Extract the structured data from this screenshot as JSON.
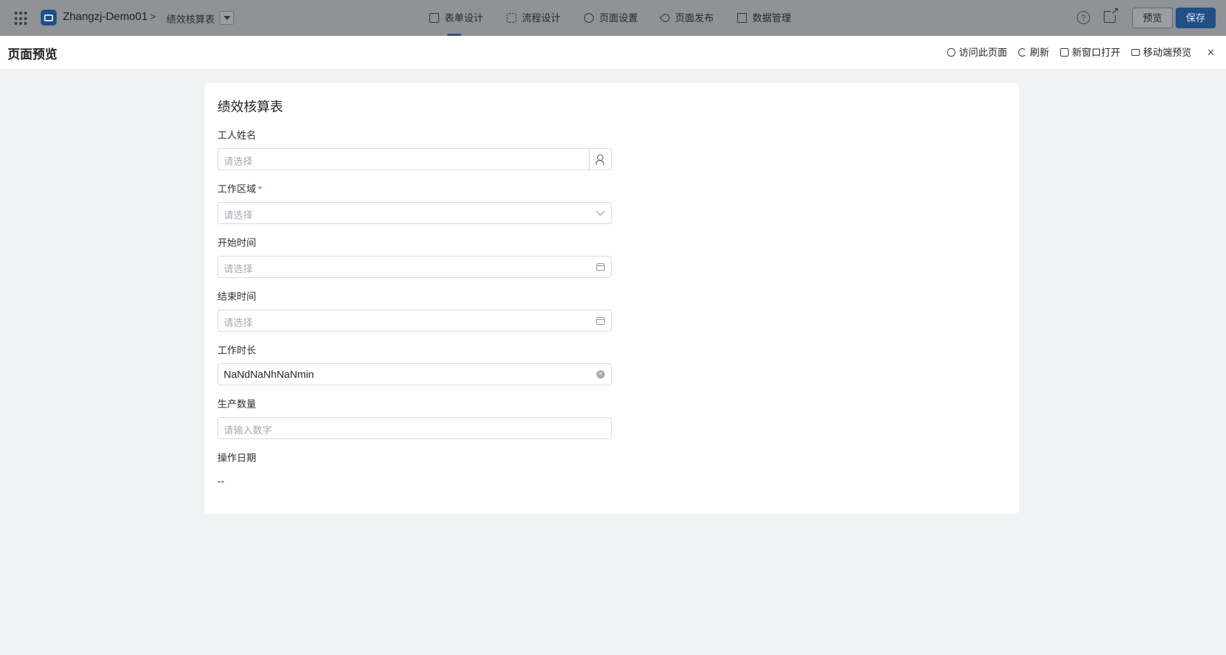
{
  "topbar": {
    "app_name": "Zhangzj-Demo01",
    "breadcrumb_separator": ">",
    "form_name": "绩效核算表",
    "tabs": [
      {
        "label": "表单设计",
        "icon": "document-icon"
      },
      {
        "label": "流程设计",
        "icon": "flow-icon"
      },
      {
        "label": "页面设置",
        "icon": "gear-icon"
      },
      {
        "label": "页面发布",
        "icon": "send-icon"
      },
      {
        "label": "数据管理",
        "icon": "table-icon"
      }
    ],
    "active_tab": "表单设计",
    "help_label": "?",
    "preview_label": "预览",
    "save_label": "保存"
  },
  "panel": {
    "title": "页面预览",
    "actions": [
      {
        "label": "访问此页面",
        "icon": "eye-icon"
      },
      {
        "label": "刷新",
        "icon": "refresh-icon"
      },
      {
        "label": "新窗口打开",
        "icon": "new-window-icon"
      },
      {
        "label": "移动端预览",
        "icon": "mobile-icon"
      }
    ],
    "close_label": "×"
  },
  "form": {
    "title": "绩效核算表",
    "fields": [
      {
        "label": "工人姓名",
        "placeholder": "请选择",
        "type": "user-select"
      },
      {
        "label": "工作区域",
        "required_mark": "*",
        "placeholder": "请选择",
        "type": "select"
      },
      {
        "label": "开始时间",
        "placeholder": "请选择",
        "type": "date"
      },
      {
        "label": "结束时间",
        "placeholder": "请选择",
        "type": "date"
      },
      {
        "label": "工作时长",
        "value": "NaNdNaNhNaNmin",
        "type": "text-clearable"
      },
      {
        "label": "生产数量",
        "placeholder": "请输入数字",
        "type": "number"
      },
      {
        "label": "操作日期",
        "value": "--",
        "type": "readonly"
      }
    ]
  },
  "colors": {
    "accent": "#1f4f86",
    "required": "#e04a3b",
    "background": "#f1f2f4"
  }
}
